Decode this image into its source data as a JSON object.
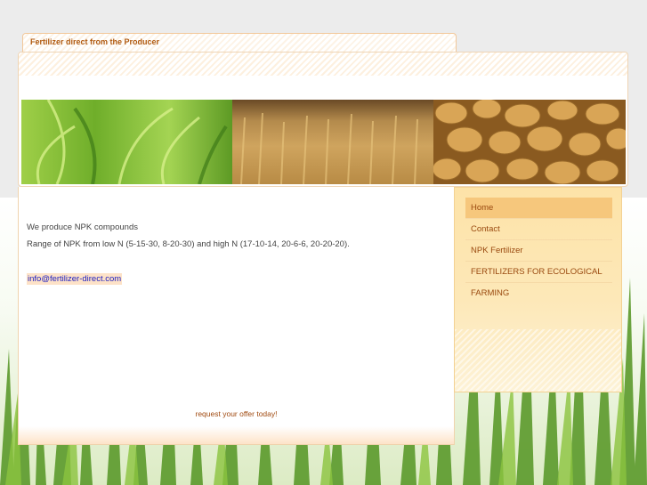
{
  "site": {
    "tagline": "Fertilizer direct from the Producer"
  },
  "banner": {
    "images": [
      {
        "subject": "green grass blades"
      },
      {
        "subject": "wheat field"
      },
      {
        "subject": "potatoes"
      }
    ]
  },
  "content": {
    "line1": "We produce NPK compounds",
    "line2": "Range of NPK from low N (5-15-30, 8-20-30) and high N (17-10-14, 20-6-6, 20-20-20).",
    "email": "info@fertilizer-direct.com",
    "offer": "request your offer today!"
  },
  "menu": {
    "items": [
      {
        "label": "Home",
        "active": true
      },
      {
        "label": "Contact"
      },
      {
        "label": "NPK Fertilizer"
      },
      {
        "label": "FERTILIZERS FOR ECOLOGICAL"
      },
      {
        "label": "FARMING"
      }
    ]
  },
  "colors": {
    "accent": "#b05a10",
    "menu_active": "#f6c77c",
    "link": "#2020c0"
  }
}
